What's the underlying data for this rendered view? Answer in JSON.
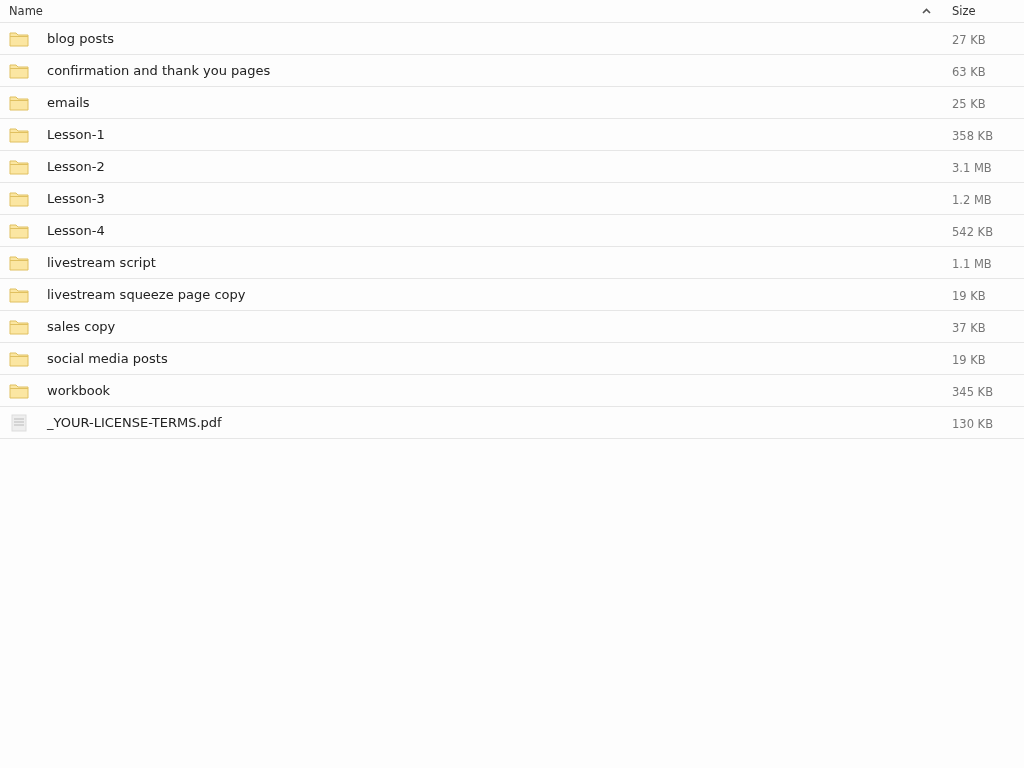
{
  "table": {
    "columns": [
      {
        "label": "Name",
        "sorted": true,
        "ascending": true
      },
      {
        "label": "Size",
        "sorted": false
      }
    ],
    "rows": [
      {
        "kind": "folder",
        "name": "blog posts",
        "size": "27 KB"
      },
      {
        "kind": "folder",
        "name": "confirmation and thank you pages",
        "size": "63 KB"
      },
      {
        "kind": "folder",
        "name": "emails",
        "size": "25 KB"
      },
      {
        "kind": "folder",
        "name": "Lesson-1",
        "size": "358 KB"
      },
      {
        "kind": "folder",
        "name": "Lesson-2",
        "size": "3.1 MB"
      },
      {
        "kind": "folder",
        "name": "Lesson-3",
        "size": "1.2 MB"
      },
      {
        "kind": "folder",
        "name": "Lesson-4",
        "size": "542 KB"
      },
      {
        "kind": "folder",
        "name": "livestream script",
        "size": "1.1 MB"
      },
      {
        "kind": "folder",
        "name": "livestream squeeze page copy",
        "size": "19 KB"
      },
      {
        "kind": "folder",
        "name": "sales copy",
        "size": "37 KB"
      },
      {
        "kind": "folder",
        "name": "social media posts",
        "size": "19 KB"
      },
      {
        "kind": "folder",
        "name": "workbook",
        "size": "345 KB"
      },
      {
        "kind": "file",
        "name": "_YOUR-LICENSE-TERMS.pdf",
        "size": "130 KB"
      }
    ]
  }
}
